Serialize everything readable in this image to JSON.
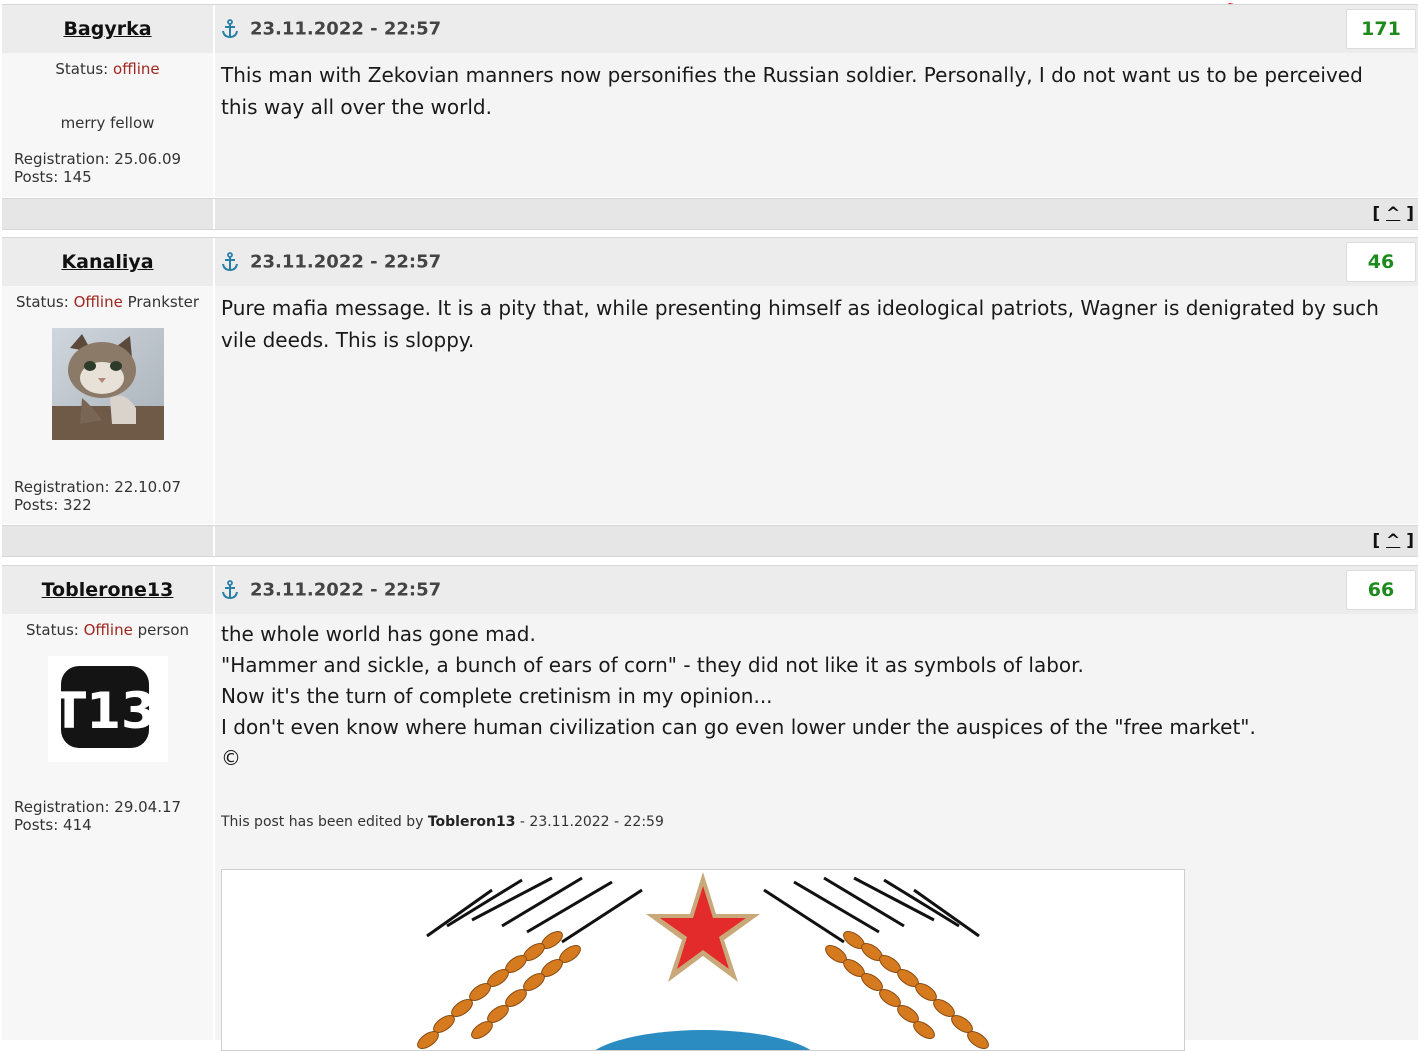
{
  "posts": [
    {
      "author": "Bagyrka",
      "date": "23.11.2022 - 22:57",
      "rating": "171",
      "status_label": "Status:",
      "status_value": "offline",
      "title": "",
      "note": "merry fellow",
      "registration": "Registration: 25.06.09",
      "posts_count": "Posts: 145",
      "text": "This man with Zekovian manners now personifies the Russian soldier. Personally, I do not want us to be perceived this way all over the world."
    },
    {
      "author": "Kanaliya",
      "date": "23.11.2022 - 22:57",
      "rating": "46",
      "status_label": "Status:",
      "status_value": "Offline",
      "title": "Prankster",
      "registration": "Registration: 22.10.07",
      "posts_count": "Posts: 322",
      "text": "Pure mafia message. It is a pity that, while presenting himself as ideological patriots, Wagner is denigrated by such vile deeds. This is sloppy.",
      "avatar": "cat-photo"
    },
    {
      "author": "Toblerone13",
      "date": "23.11.2022 - 22:57",
      "rating": "66",
      "status_label": "Status:",
      "status_value": "Offline",
      "title": "person",
      "registration": "Registration: 29.04.17",
      "posts_count": "Posts: 414",
      "lines": [
        "the whole world has gone mad.",
        "\"Hammer and sickle, a bunch of ears of corn\" - they did not like it as symbols of labor.",
        "Now it's the turn of complete cretinism in my opinion...",
        "I don't even know where human civilization can go even lower under the auspices of the \"free market\".",
        "©"
      ],
      "edit_prefix": "This post has been edited by",
      "edit_user": "Tobleron13",
      "edit_suffix": "- 23.11.2022 - 22:59",
      "avatar_text": "T13"
    }
  ],
  "top_link": {
    "open": "[",
    "caret": "^",
    "close": "]"
  },
  "colors": {
    "rating": "#1e8a1e",
    "offline": "#a0261f",
    "arrow": "#e0202a"
  }
}
